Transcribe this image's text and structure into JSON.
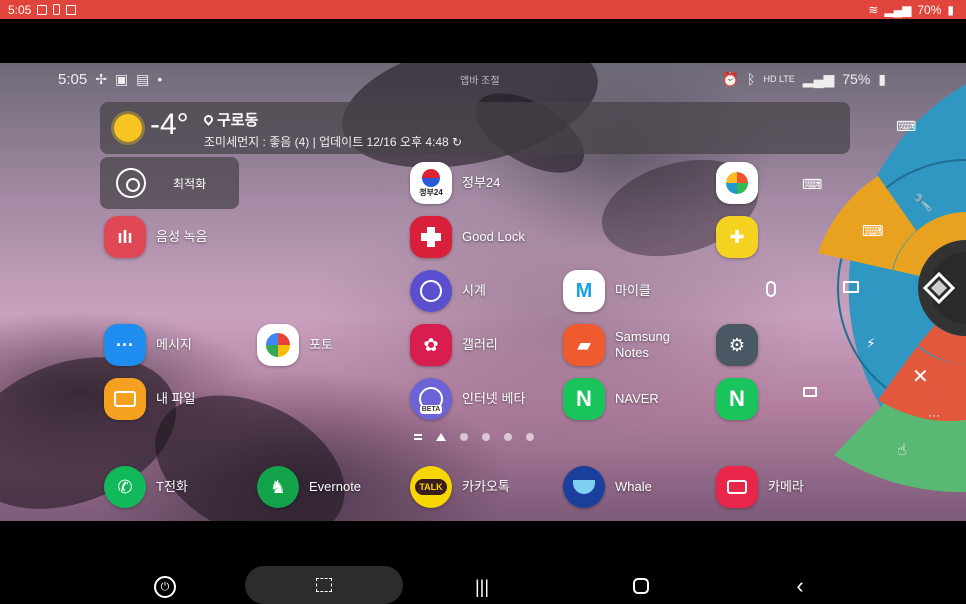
{
  "host_status": {
    "time": "5:05",
    "battery": "70%"
  },
  "remote_status": {
    "time": "5:05",
    "center_text": "앱바 조절",
    "network": "HD LTE",
    "battery": "75%"
  },
  "weather": {
    "temperature": "-4°",
    "location": "구로동",
    "info": "조미세먼지 : 좋음 (4) | 업데이트 12/16 오후 4:48"
  },
  "optimize": {
    "label": "최적화"
  },
  "apps": {
    "voice": "음성 녹음",
    "gov24": "정부24",
    "gov24_badge": "정부24",
    "goodlock": "Good Lock",
    "clock": "시계",
    "mycoupon": "마이클",
    "messages": "메시지",
    "photos": "포토",
    "gallery": "갤러리",
    "notes": "Samsung Notes",
    "myfiles": "내 파일",
    "internet": "인터넷 베타",
    "internet_badge": "BETA",
    "naver": "NAVER",
    "tphone": "T전화",
    "evernote": "Evernote",
    "kakao": "카카오톡",
    "kakao_badge": "TALK",
    "whale": "Whale",
    "camera": "카메라"
  },
  "colors": {
    "radial_blue": "#2f97c1",
    "radial_orange": "#e8a21f",
    "radial_red": "#e2583c",
    "radial_green": "#59b873",
    "host_bar": "#e0443a"
  }
}
